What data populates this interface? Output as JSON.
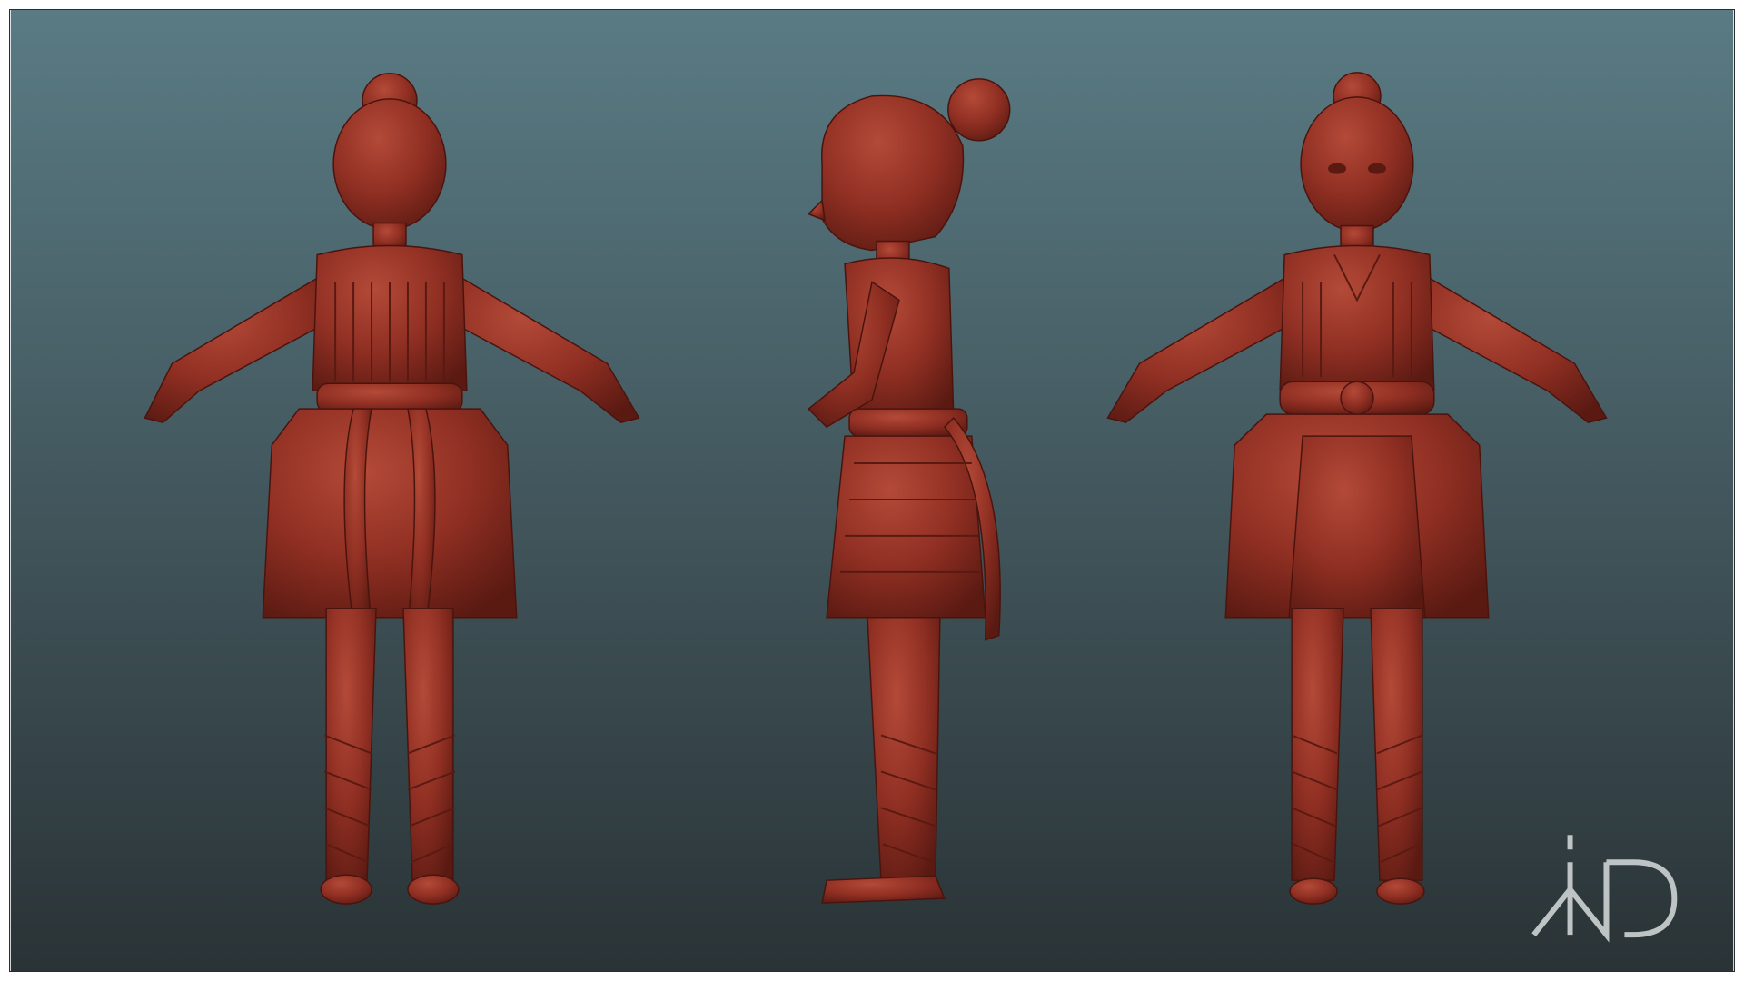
{
  "scene": {
    "background_top": "#5a7b84",
    "background_bottom": "#2a3336",
    "sculpt_color": "#8e2e22",
    "sculpt_highlight": "#b44a38",
    "sculpt_shadow": "#5a1a12"
  },
  "views": [
    {
      "name": "back-view"
    },
    {
      "name": "side-view"
    },
    {
      "name": "front-view"
    }
  ],
  "logo": {
    "color": "#d8dcdd",
    "text": "iMD"
  }
}
